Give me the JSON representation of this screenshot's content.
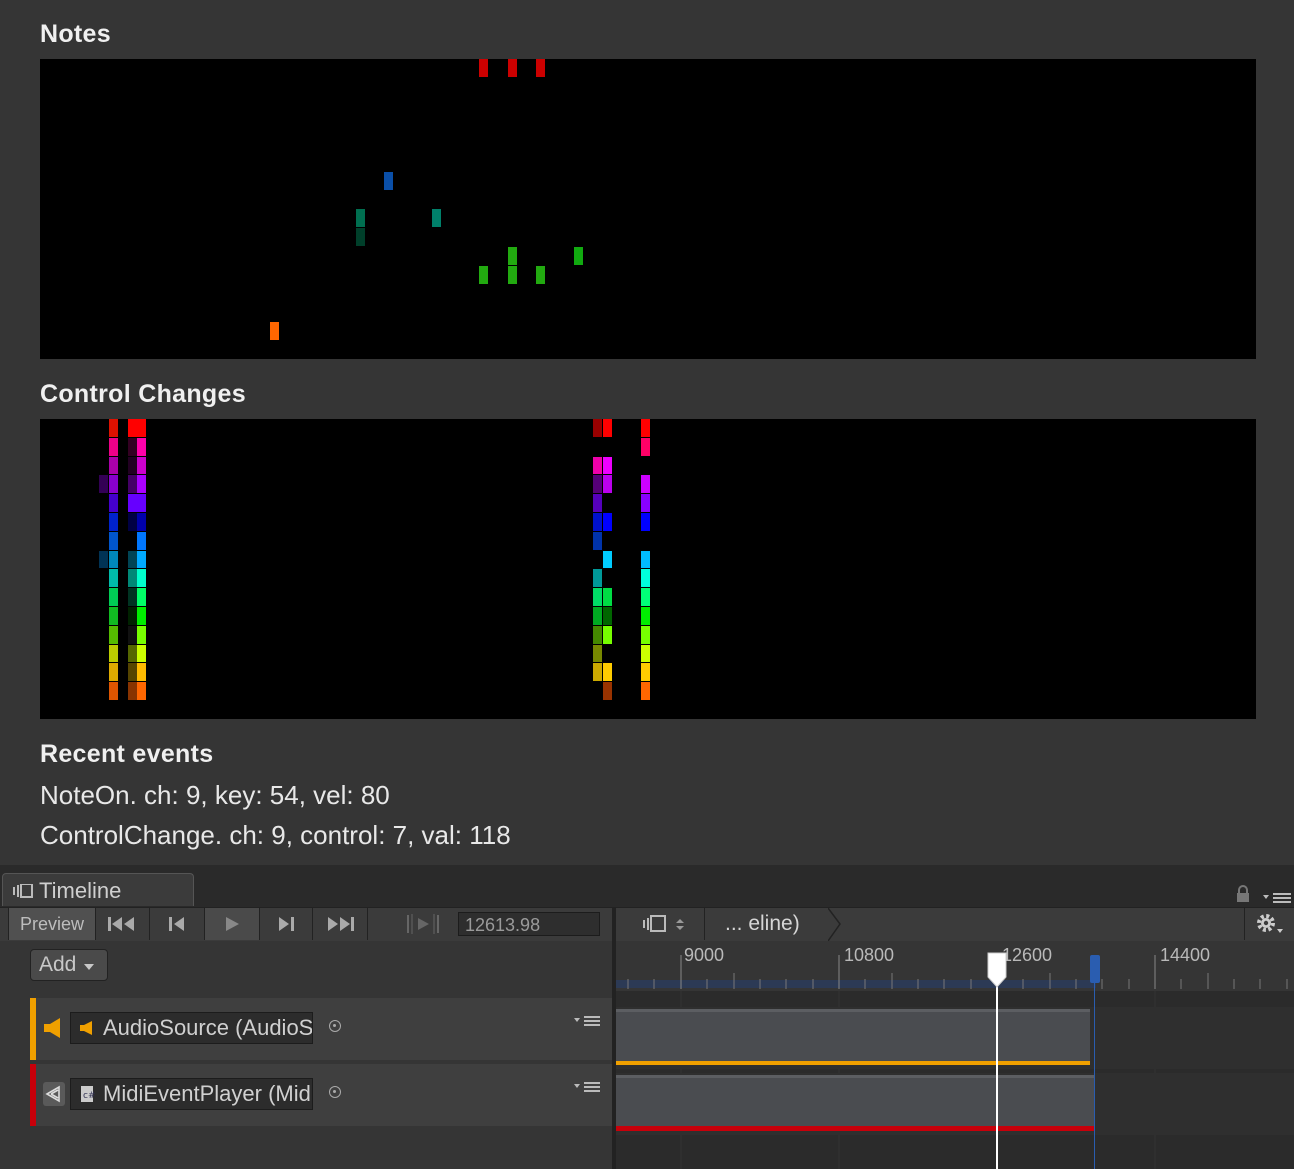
{
  "notes": {
    "heading": "Notes",
    "cells": [
      {
        "col": 46,
        "row": 0,
        "color": "#cc0000"
      },
      {
        "col": 49,
        "row": 0,
        "color": "#cc0000"
      },
      {
        "col": 52,
        "row": 0,
        "color": "#cc0000"
      },
      {
        "col": 36,
        "row": 6,
        "color": "#0a4fa8"
      },
      {
        "col": 33,
        "row": 8,
        "color": "#006f50"
      },
      {
        "col": 33,
        "row": 9,
        "color": "#003f2a"
      },
      {
        "col": 41,
        "row": 8,
        "color": "#00806a"
      },
      {
        "col": 49,
        "row": 10,
        "color": "#22aa10"
      },
      {
        "col": 56,
        "row": 10,
        "color": "#11aa10"
      },
      {
        "col": 46,
        "row": 11,
        "color": "#22aa10"
      },
      {
        "col": 49,
        "row": 11,
        "color": "#22aa10"
      },
      {
        "col": 52,
        "row": 11,
        "color": "#22aa10"
      },
      {
        "col": 24,
        "row": 14,
        "color": "#ff6600"
      }
    ]
  },
  "control_changes": {
    "heading": "Control Changes",
    "cells": [
      {
        "col": 7,
        "row": 0,
        "color": "#dd1100"
      },
      {
        "col": 7,
        "row": 1,
        "color": "#ee0088"
      },
      {
        "col": 7,
        "row": 2,
        "color": "#aa00aa"
      },
      {
        "col": 7,
        "row": 3,
        "color": "#8800cc"
      },
      {
        "col": 6,
        "row": 3,
        "color": "#330055"
      },
      {
        "col": 7,
        "row": 4,
        "color": "#4400cc"
      },
      {
        "col": 7,
        "row": 5,
        "color": "#0022cc"
      },
      {
        "col": 7,
        "row": 6,
        "color": "#0055cc"
      },
      {
        "col": 7,
        "row": 7,
        "color": "#0088bb"
      },
      {
        "col": 6,
        "row": 7,
        "color": "#003355"
      },
      {
        "col": 7,
        "row": 8,
        "color": "#00bbaa"
      },
      {
        "col": 7,
        "row": 9,
        "color": "#00cc55"
      },
      {
        "col": 7,
        "row": 10,
        "color": "#11bb22"
      },
      {
        "col": 7,
        "row": 11,
        "color": "#55bb00"
      },
      {
        "col": 7,
        "row": 12,
        "color": "#bbcc00"
      },
      {
        "col": 7,
        "row": 13,
        "color": "#ddaa00"
      },
      {
        "col": 7,
        "row": 14,
        "color": "#dd5500"
      },
      {
        "col": 9,
        "row": 0,
        "color": "#ff0000"
      },
      {
        "col": 10,
        "row": 0,
        "color": "#ff0000"
      },
      {
        "col": 9,
        "row": 1,
        "color": "#330022"
      },
      {
        "col": 10,
        "row": 1,
        "color": "#ff00aa"
      },
      {
        "col": 9,
        "row": 2,
        "color": "#220022"
      },
      {
        "col": 10,
        "row": 2,
        "color": "#cc00cc"
      },
      {
        "col": 9,
        "row": 3,
        "color": "#440066"
      },
      {
        "col": 10,
        "row": 3,
        "color": "#aa00ff"
      },
      {
        "col": 9,
        "row": 4,
        "color": "#6600ff"
      },
      {
        "col": 10,
        "row": 4,
        "color": "#6600ff"
      },
      {
        "col": 9,
        "row": 5,
        "color": "#000044"
      },
      {
        "col": 10,
        "row": 5,
        "color": "#0000aa"
      },
      {
        "col": 9,
        "row": 6,
        "color": "#000000"
      },
      {
        "col": 10,
        "row": 6,
        "color": "#0077ff"
      },
      {
        "col": 9,
        "row": 7,
        "color": "#004455"
      },
      {
        "col": 10,
        "row": 7,
        "color": "#00aaff"
      },
      {
        "col": 9,
        "row": 8,
        "color": "#008877"
      },
      {
        "col": 10,
        "row": 8,
        "color": "#00ffcc"
      },
      {
        "col": 9,
        "row": 9,
        "color": "#003322"
      },
      {
        "col": 10,
        "row": 9,
        "color": "#00ff66"
      },
      {
        "col": 9,
        "row": 10,
        "color": "#002200"
      },
      {
        "col": 10,
        "row": 10,
        "color": "#00ee00"
      },
      {
        "col": 9,
        "row": 11,
        "color": "#111111"
      },
      {
        "col": 10,
        "row": 11,
        "color": "#77ff00"
      },
      {
        "col": 9,
        "row": 12,
        "color": "#556600"
      },
      {
        "col": 10,
        "row": 12,
        "color": "#ccff00"
      },
      {
        "col": 9,
        "row": 13,
        "color": "#554400"
      },
      {
        "col": 10,
        "row": 13,
        "color": "#ffbb00"
      },
      {
        "col": 9,
        "row": 14,
        "color": "#883300"
      },
      {
        "col": 10,
        "row": 14,
        "color": "#ff6600"
      },
      {
        "col": 58,
        "row": 0,
        "color": "#990000"
      },
      {
        "col": 59,
        "row": 0,
        "color": "#ff0000"
      },
      {
        "col": 58,
        "row": 2,
        "color": "#ee00aa"
      },
      {
        "col": 59,
        "row": 2,
        "color": "#ee00ff"
      },
      {
        "col": 58,
        "row": 3,
        "color": "#550077"
      },
      {
        "col": 59,
        "row": 3,
        "color": "#bb00ee"
      },
      {
        "col": 58,
        "row": 4,
        "color": "#5500bb"
      },
      {
        "col": 58,
        "row": 5,
        "color": "#0011cc"
      },
      {
        "col": 59,
        "row": 5,
        "color": "#0000ff"
      },
      {
        "col": 58,
        "row": 6,
        "color": "#0033aa"
      },
      {
        "col": 59,
        "row": 7,
        "color": "#00ccff"
      },
      {
        "col": 58,
        "row": 8,
        "color": "#009999"
      },
      {
        "col": 58,
        "row": 9,
        "color": "#00dd66"
      },
      {
        "col": 59,
        "row": 9,
        "color": "#00dd44"
      },
      {
        "col": 58,
        "row": 10,
        "color": "#00aa22"
      },
      {
        "col": 59,
        "row": 10,
        "color": "#006600"
      },
      {
        "col": 58,
        "row": 11,
        "color": "#448800"
      },
      {
        "col": 59,
        "row": 11,
        "color": "#77ff00"
      },
      {
        "col": 58,
        "row": 12,
        "color": "#778800"
      },
      {
        "col": 58,
        "row": 13,
        "color": "#ccaa00"
      },
      {
        "col": 59,
        "row": 13,
        "color": "#ffcc00"
      },
      {
        "col": 59,
        "row": 14,
        "color": "#993300"
      },
      {
        "col": 63,
        "row": 0,
        "color": "#ff0000"
      },
      {
        "col": 63,
        "row": 1,
        "color": "#ff0066"
      },
      {
        "col": 63,
        "row": 3,
        "color": "#cc00ff"
      },
      {
        "col": 63,
        "row": 4,
        "color": "#8800ff"
      },
      {
        "col": 63,
        "row": 5,
        "color": "#0000ff"
      },
      {
        "col": 63,
        "row": 7,
        "color": "#00bbff"
      },
      {
        "col": 63,
        "row": 8,
        "color": "#00ffdd"
      },
      {
        "col": 63,
        "row": 9,
        "color": "#00ff77"
      },
      {
        "col": 63,
        "row": 10,
        "color": "#00ee00"
      },
      {
        "col": 63,
        "row": 11,
        "color": "#77ff00"
      },
      {
        "col": 63,
        "row": 12,
        "color": "#ccff00"
      },
      {
        "col": 63,
        "row": 13,
        "color": "#ffcc00"
      },
      {
        "col": 63,
        "row": 14,
        "color": "#ff6600"
      }
    ]
  },
  "recent_events": {
    "heading": "Recent events",
    "lines": [
      "NoteOn. ch: 9, key: 54, vel: 80",
      "ControlChange. ch: 9, control: 7, val: 118"
    ]
  },
  "timeline": {
    "tab_label": "Timeline",
    "preview_label": "Preview",
    "current_time": "12613.98",
    "breadcrumb": "... eline)",
    "add_label": "Add",
    "ruler_labels": [
      "9000",
      "10800",
      "12600",
      "14400"
    ],
    "tracks": [
      {
        "label": "AudioSource (AudioSource)",
        "color": "#f0a000",
        "icon": "speaker-icon"
      },
      {
        "label": "MidiEventPlayer (MidiEventPlayer)",
        "color": "#c8000a",
        "icon": "unity-logo-icon"
      }
    ]
  },
  "colors": {
    "background": "#353535",
    "panel": "#000000",
    "audio_track": "#f0a000",
    "midi_track": "#c8000a",
    "playhead": "#ffffff",
    "end_marker": "#2a5db0"
  }
}
